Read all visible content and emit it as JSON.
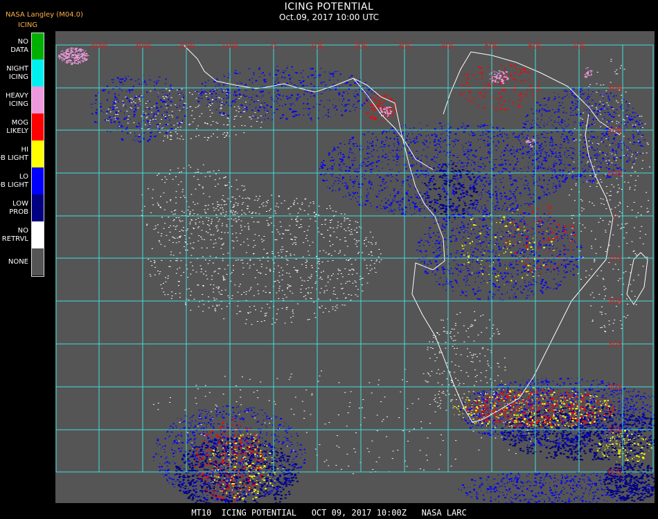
{
  "header": {
    "credit": "NASA Langley (M04.0)",
    "variable": "ICING",
    "title": "ICING POTENTIAL",
    "datetime": "Oct.09, 2017 10:00 UTC"
  },
  "legend": [
    {
      "label": "NO DATA",
      "color": "#00b000"
    },
    {
      "label": "NIGHT ICING",
      "color": "#00f0f0"
    },
    {
      "label": "HEAVY ICING",
      "color": "#ee99dd"
    },
    {
      "label": "MOG LIKELY",
      "color": "#ff0000"
    },
    {
      "label": "HI PROB LIGHT",
      "color": "#ffff00"
    },
    {
      "label": "LO PROB LIGHT",
      "color": "#0000ff"
    },
    {
      "label": "LOW PROB",
      "color": "#000080"
    },
    {
      "label": "NO RETRVL",
      "color": "#ffffff"
    },
    {
      "label": "NONE",
      "color": "#555555"
    }
  ],
  "map": {
    "background_color": "#555555",
    "grid_color": "#40e0e0",
    "coast_color": "#ffffff",
    "label_color": "#cc2222",
    "top_labels": [
      "40W",
      "30W",
      "20W",
      "10W",
      "0",
      "10E",
      "20E",
      "30E",
      "40E",
      "50E",
      "60E",
      "70E"
    ],
    "right_labels": [
      "30N",
      "20N",
      "10N",
      "0",
      "10S",
      "20S",
      "30S",
      "40S",
      "50S",
      "60S"
    ]
  },
  "footer": "MT10  ICING POTENTIAL   OCT 09, 2017 10:00Z   NASA LARC"
}
